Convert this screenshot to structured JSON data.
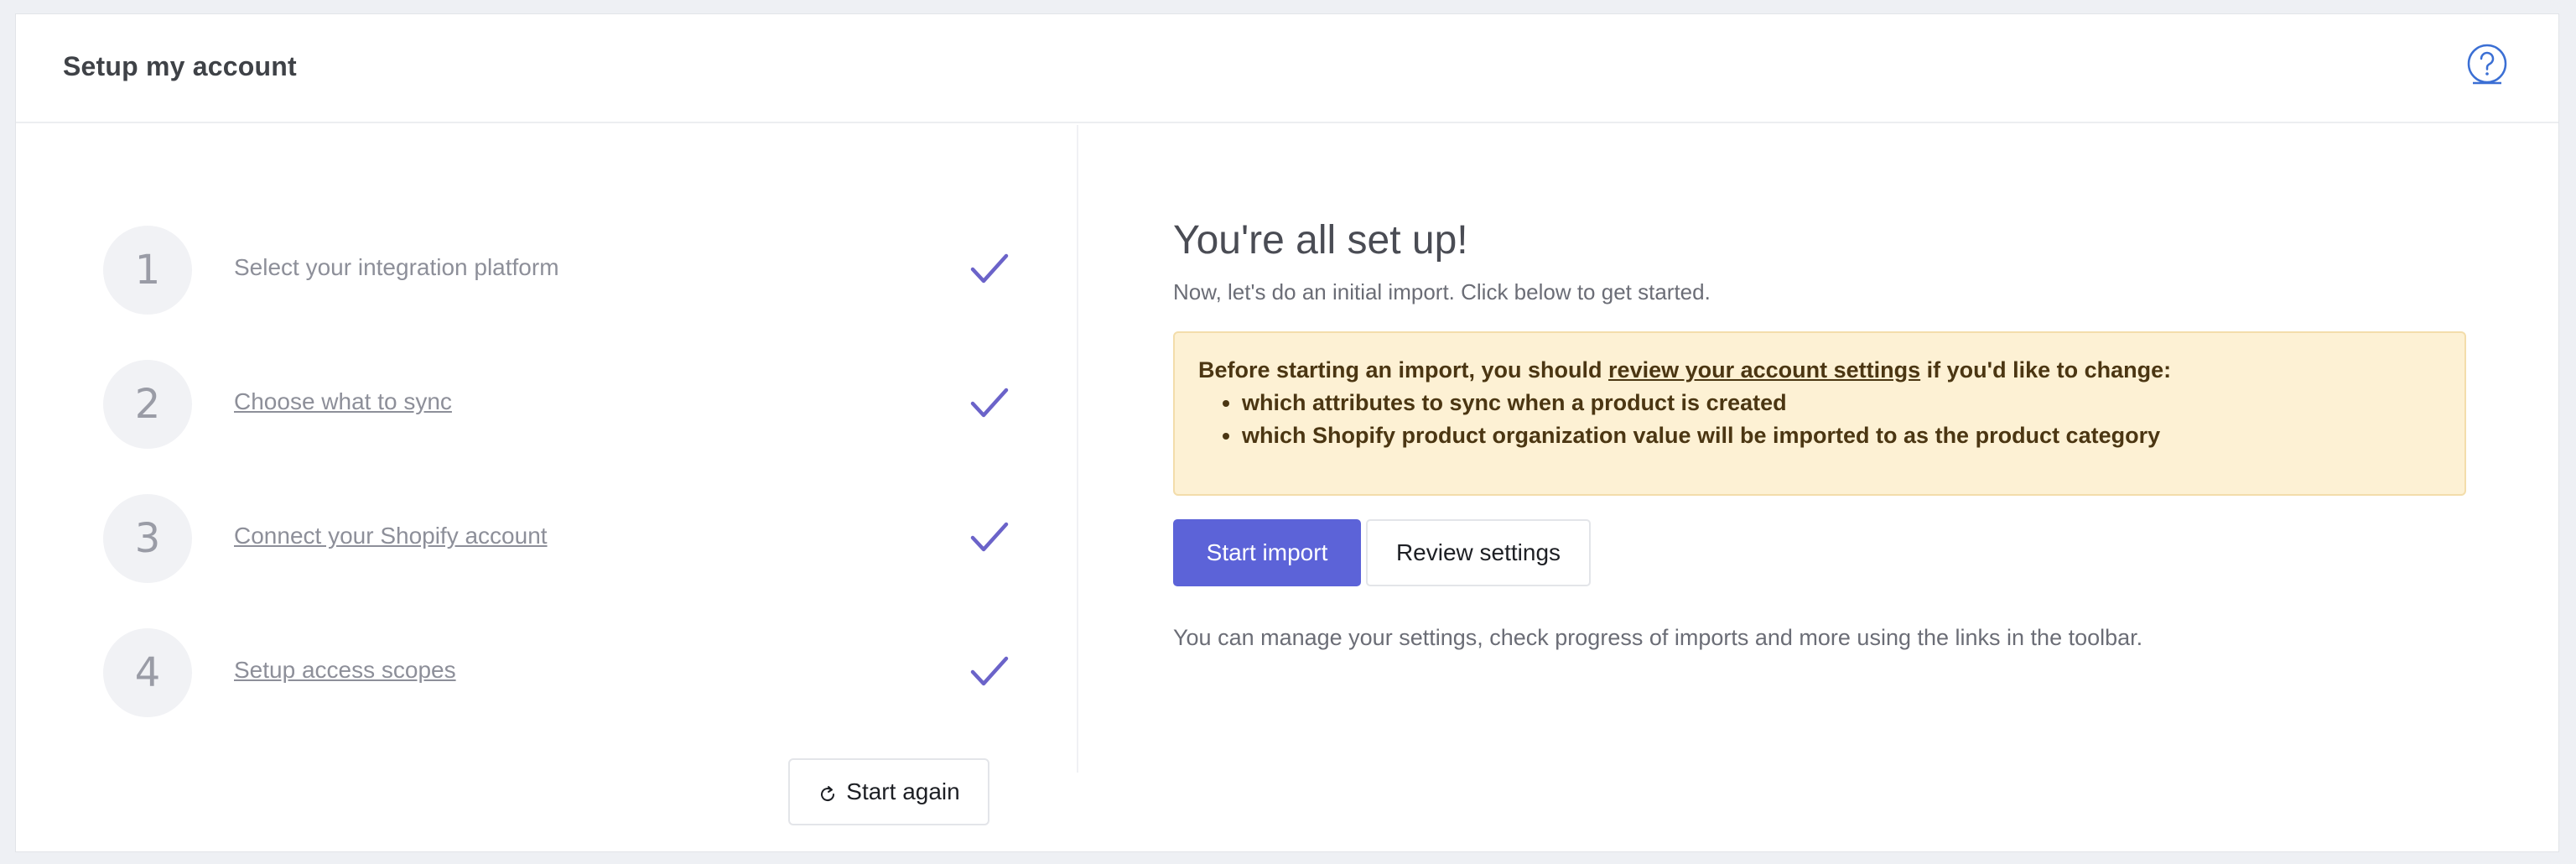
{
  "header": {
    "title": "Setup my account",
    "help_icon": "question-circle-icon"
  },
  "steps": [
    {
      "number": "1",
      "label": "Select your integration platform",
      "linked": false,
      "status": "complete",
      "status_icon": "check-icon"
    },
    {
      "number": "2",
      "label": "Choose what to sync",
      "linked": true,
      "status": "complete",
      "status_icon": "check-icon"
    },
    {
      "number": "3",
      "label": "Connect your Shopify account",
      "linked": true,
      "status": "complete",
      "status_icon": "check-icon"
    },
    {
      "number": "4",
      "label": "Setup access scopes",
      "linked": true,
      "status": "complete",
      "status_icon": "check-icon"
    }
  ],
  "start_again": {
    "label": "Start again",
    "icon": "refresh-icon"
  },
  "main": {
    "title": "You're all set up!",
    "subtitle": "Now, let's do an initial import. Click below to get started.",
    "notice": {
      "intro_before": "Before starting an import, you should ",
      "intro_link": "review your account settings",
      "intro_after": " if you'd like to change:",
      "items": [
        "which attributes to sync when a product is created",
        "which Shopify product organization value will be imported to as the product category"
      ]
    },
    "start_import_label": "Start import",
    "review_settings_label": "Review settings",
    "footnote": "You can manage your settings, check progress of imports and more using the links in the toolbar."
  },
  "colors": {
    "accent": "#5c63d8",
    "check": "#6b63c9",
    "notice_bg": "#fdf1d4",
    "notice_border": "#f3ddab",
    "notice_text": "#4b3612",
    "help_icon": "#3b6fd4"
  }
}
